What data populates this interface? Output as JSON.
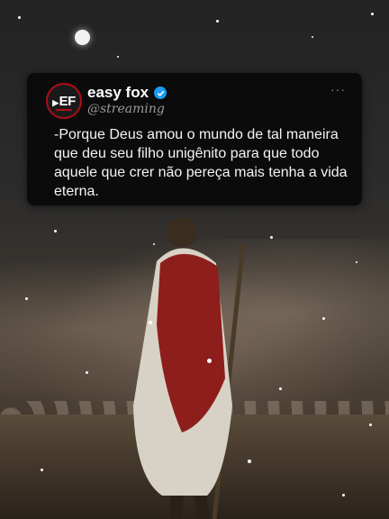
{
  "post": {
    "author_name": "easy fox",
    "handle": "@streaming",
    "avatar_text": "EF",
    "more_label": "···",
    "text": "-Porque Deus amou o mundo de tal maneira que deu seu filho unigênito para que todo aquele que crer não pereça mais tenha a vida eterna."
  },
  "colors": {
    "card_bg": "#0b0b0b",
    "verified": "#1d9bf0",
    "avatar_ring": "#b00d18"
  },
  "icons": {
    "verified": "verified-badge-icon",
    "more": "more-options-icon"
  }
}
